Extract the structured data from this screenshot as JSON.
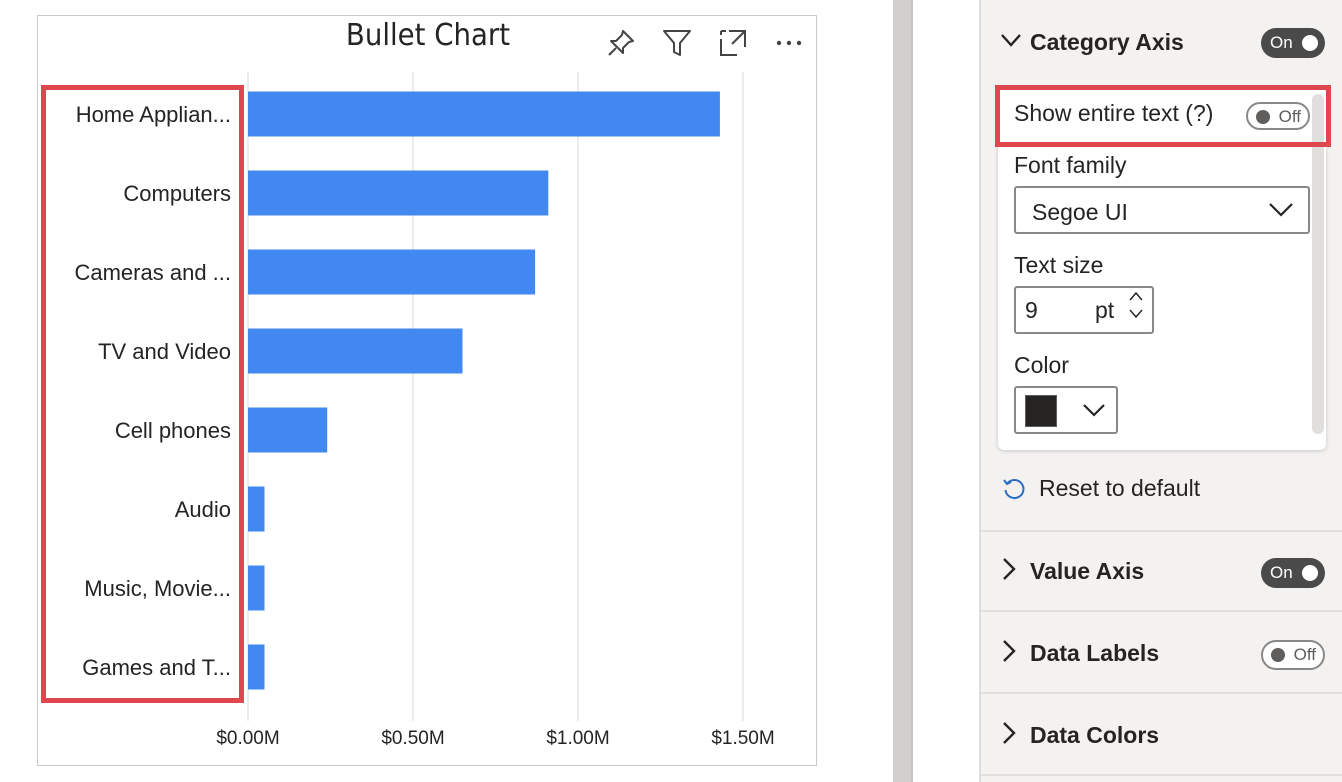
{
  "visual": {
    "title": "Bullet Chart",
    "header_icons": [
      "pin-icon",
      "filter-icon",
      "focus-mode-icon",
      "more-options-icon"
    ]
  },
  "chart_data": {
    "type": "bar",
    "orientation": "horizontal",
    "categories": [
      "Home Applian...",
      "Computers",
      "Cameras and ...",
      "TV and Video",
      "Cell phones",
      "Audio",
      "Music, Movie...",
      "Games and T..."
    ],
    "values": [
      1.43,
      0.91,
      0.87,
      0.65,
      0.24,
      0.05,
      0.05,
      0.05
    ],
    "x_ticks": [
      "$0.00M",
      "$0.50M",
      "$1.00M",
      "$1.50M"
    ],
    "x_tick_values": [
      0,
      0.5,
      1.0,
      1.5
    ],
    "xlim": [
      0,
      1.5
    ],
    "unit": "$M",
    "bar_color": "#4189f1",
    "grid": true,
    "title": "Bullet Chart"
  },
  "format_pane": {
    "category_axis": {
      "title": "Category Axis",
      "toggle": "On",
      "show_entire_text_label": "Show entire text (?)",
      "show_entire_text_toggle": "Off",
      "font_family_label": "Font family",
      "font_family_value": "Segoe UI",
      "text_size_label": "Text size",
      "text_size_value": "9",
      "text_size_unit": "pt",
      "color_label": "Color",
      "color_value": "#252423",
      "reset_label": "Reset to default"
    },
    "sections": [
      {
        "title": "Value Axis",
        "toggle": "On"
      },
      {
        "title": "Data Labels",
        "toggle": "Off"
      },
      {
        "title": "Data Colors",
        "toggle": ""
      }
    ]
  },
  "colors": {
    "highlight": "#e0464e",
    "accent_blue": "#4189f1",
    "toggle_on": "#4a4a4a"
  }
}
